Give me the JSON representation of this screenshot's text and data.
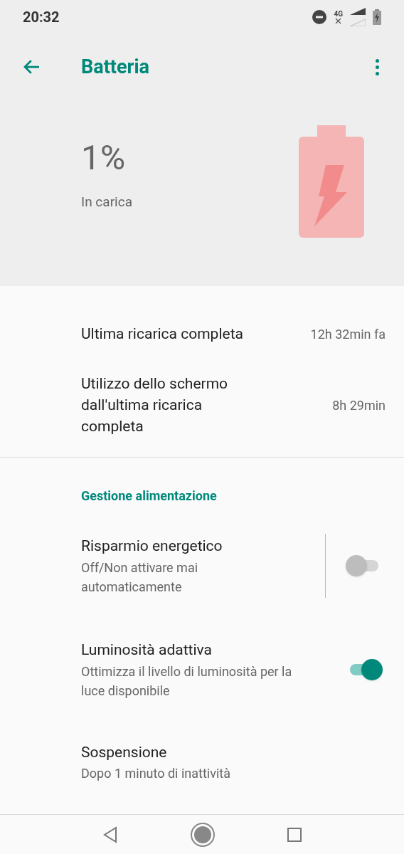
{
  "status_bar": {
    "time": "20:32",
    "network_type": "4G"
  },
  "toolbar": {
    "title": "Batteria"
  },
  "battery": {
    "percent": "1%",
    "status": "In carica",
    "charging": true
  },
  "info_rows": [
    {
      "label": "Ultima ricarica completa",
      "value": "12h 32min fa"
    },
    {
      "label": "Utilizzo dello schermo dall'ultima ricarica completa",
      "value": "8h 29min"
    }
  ],
  "category": {
    "title": "Gestione alimentazione"
  },
  "settings": [
    {
      "kind": "switch",
      "title": "Risparmio energetico",
      "summary": "Off/Non attivare mai automaticamente",
      "on": false,
      "divider": true
    },
    {
      "kind": "switch",
      "title": "Luminosità adattiva",
      "summary": "Ottimizza il livello di luminosità per la luce disponibile",
      "on": true,
      "divider": false
    },
    {
      "kind": "plain",
      "title": "Sospensione",
      "summary": "Dopo 1 minuto di inattività"
    }
  ]
}
